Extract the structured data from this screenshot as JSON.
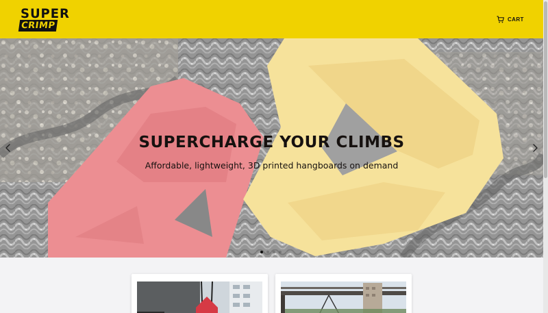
{
  "header": {
    "logo_top": "SUPER",
    "logo_bottom": "CRIMP",
    "cart_label": "CART",
    "cart_icon": "cart-icon",
    "background_color": "#f0d200"
  },
  "hero": {
    "title": "SUPERCHARGE YOUR CLIMBS",
    "subtitle": "Affordable, lightweight, 3D printed hangboards on demand",
    "prev_icon": "chevron-left-icon",
    "next_icon": "chevron-right-icon",
    "slide_count": 4,
    "active_slide": 1,
    "colors": {
      "red_hold": "#e8767b",
      "yellow_hold": "#f5dc86"
    }
  },
  "products": [
    {
      "image": "red-hangboard-photo"
    },
    {
      "image": "hanging-hangboard-photo"
    }
  ]
}
